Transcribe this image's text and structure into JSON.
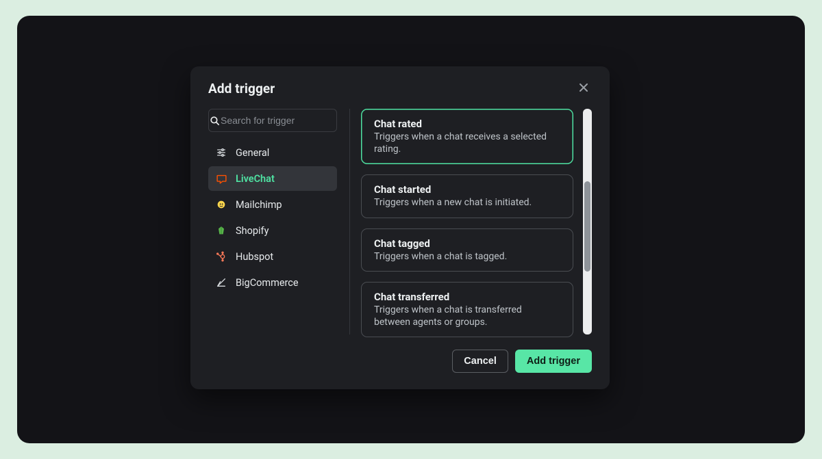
{
  "modal": {
    "title": "Add trigger"
  },
  "search": {
    "placeholder": "Search for trigger",
    "value": ""
  },
  "categories": [
    {
      "id": "general",
      "label": "General",
      "icon": "sliders",
      "color": "#d9dde0"
    },
    {
      "id": "livechat",
      "label": "LiveChat",
      "icon": "chat",
      "color": "#ff5100"
    },
    {
      "id": "mailchimp",
      "label": "Mailchimp",
      "icon": "mailchimp",
      "color": "#ffd84d"
    },
    {
      "id": "shopify",
      "label": "Shopify",
      "icon": "shopify",
      "color": "#58b44a"
    },
    {
      "id": "hubspot",
      "label": "Hubspot",
      "icon": "hubspot",
      "color": "#ff7a59"
    },
    {
      "id": "bigcommerce",
      "label": "BigCommerce",
      "icon": "bigcom",
      "color": "#d9dde0"
    }
  ],
  "active_category": "livechat",
  "triggers": [
    {
      "id": "chat_rated",
      "title": "Chat rated",
      "description": "Triggers when a chat receives a selected rating.",
      "selected": true
    },
    {
      "id": "chat_started",
      "title": "Chat started",
      "description": "Triggers when a new chat is initiated.",
      "selected": false
    },
    {
      "id": "chat_tagged",
      "title": "Chat tagged",
      "description": "Triggers when a chat is tagged.",
      "selected": false
    },
    {
      "id": "chat_transferred",
      "title": "Chat transferred",
      "description": "Triggers when a chat is transferred between agents or groups.",
      "selected": false
    }
  ],
  "buttons": {
    "cancel": "Cancel",
    "submit": "Add trigger"
  },
  "colors": {
    "accent": "#4fe3a3",
    "surface": "#1e1f23",
    "backdrop": "#131317"
  }
}
